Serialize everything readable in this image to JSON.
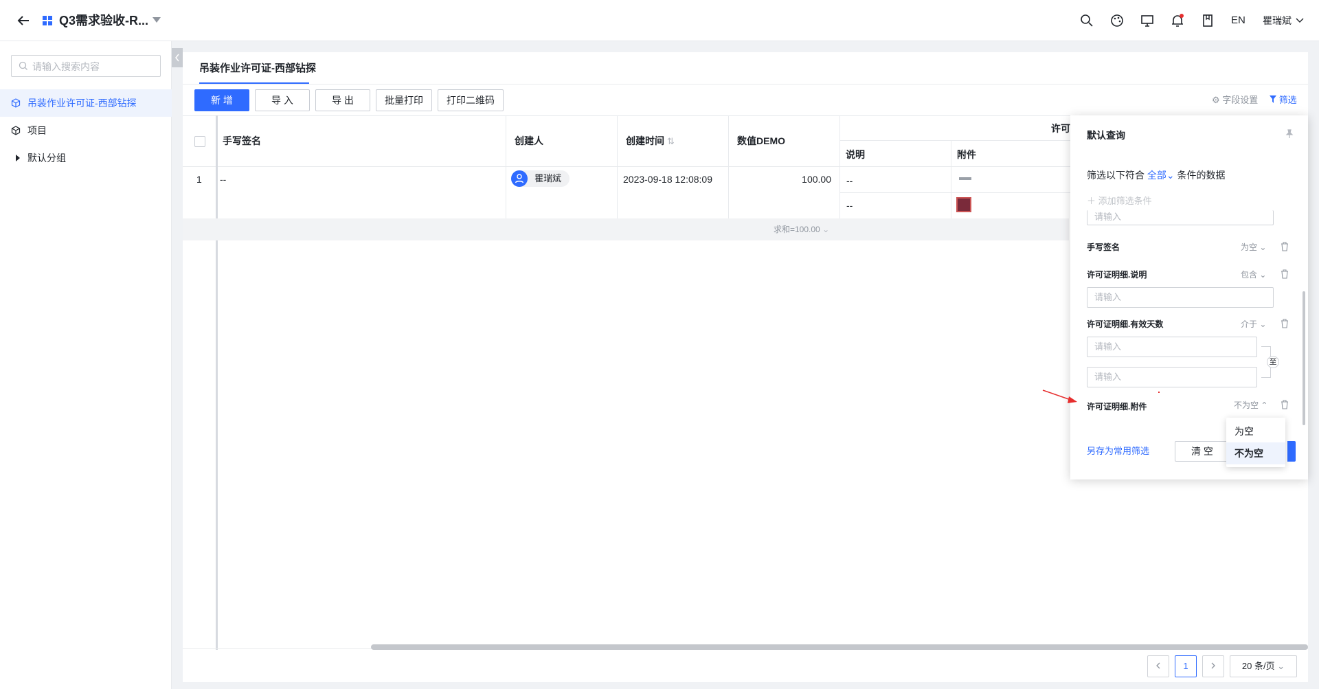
{
  "header": {
    "title": "Q3需求验收-R...",
    "lang": "EN",
    "user": "瞿瑞斌"
  },
  "sidebar": {
    "search_placeholder": "请输入搜索内容",
    "items": [
      {
        "label": "吊装作业许可证-西部钻探"
      },
      {
        "label": "项目"
      },
      {
        "label": "默认分组"
      }
    ]
  },
  "page": {
    "tab_title": "吊装作业许可证-西部钻探",
    "toolbar": {
      "add": "新 增",
      "import": "导 入",
      "export": "导 出",
      "batch_print": "批量打印",
      "print_qr": "打印二维码",
      "field_settings": "字段设置",
      "filter": "筛选"
    },
    "table": {
      "headers": {
        "signature": "手写签名",
        "creator": "创建人",
        "created_time": "创建时间",
        "demo": "数值DEMO",
        "group": "许可",
        "desc": "说明",
        "attachment": "附件"
      },
      "row": {
        "index": "1",
        "signature": "--",
        "creator": "瞿瑞斌",
        "created_time": "2023-09-18 12:08:09",
        "demo": "100.00",
        "sub": [
          {
            "desc": "--"
          },
          {
            "desc": "--"
          }
        ]
      },
      "sum": "求和=100.00"
    },
    "pagination": {
      "current": "1",
      "page_size": "20 条/页"
    }
  },
  "filter_panel": {
    "title": "默认查询",
    "match_prefix": "筛选以下符合",
    "match_mode": "全部",
    "match_suffix": "条件的数据",
    "add_condition": "添加筛选条件",
    "input_placeholder": "请输入",
    "conditions": [
      {
        "label": "手写签名",
        "op": "为空"
      },
      {
        "label": "许可证明细.说明",
        "op": "包含"
      },
      {
        "label": "许可证明细.有效天数",
        "op": "介于"
      },
      {
        "label": "许可证明细.附件",
        "op": "不为空"
      }
    ],
    "range_sep": "至",
    "save_common": "另存为常用筛选",
    "clear": "清 空",
    "dropdown_options": [
      "为空",
      "不为空"
    ],
    "selected_option": "不为空"
  },
  "colors": {
    "accent": "#2f6bff",
    "annotation_arrow": "#e62e2e"
  }
}
